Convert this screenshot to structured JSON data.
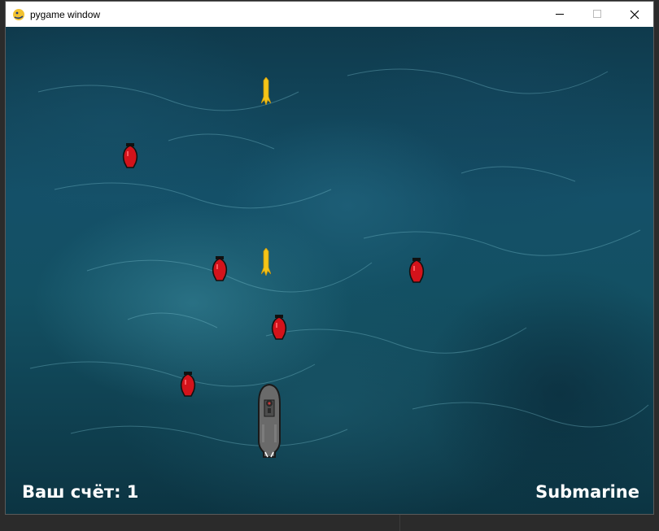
{
  "window": {
    "title": "pygame window",
    "minimize_glyph": "—",
    "maximize_glyph": "☐",
    "close_glyph": "✕"
  },
  "game": {
    "score_text": "Ваш счёт: 1",
    "game_title": "Submarine",
    "colors": {
      "water_dark": "#0c3442",
      "water_light": "#2f8ba0",
      "mine_red": "#d3131b",
      "torpedo_yellow": "#f5c518",
      "submarine_gray": "#6a6a6a"
    },
    "sprites": {
      "mines": [
        {
          "name": "mine-1"
        },
        {
          "name": "mine-2"
        },
        {
          "name": "mine-3"
        },
        {
          "name": "mine-4"
        },
        {
          "name": "mine-5"
        }
      ],
      "torpedoes": [
        {
          "name": "torpedo-1"
        },
        {
          "name": "torpedo-2"
        }
      ],
      "player": {
        "name": "submarine"
      }
    }
  }
}
